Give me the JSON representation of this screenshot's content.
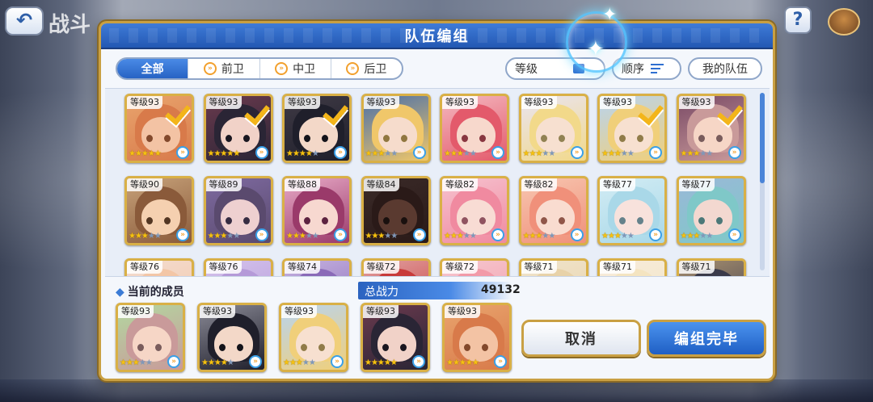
{
  "background": {
    "title": "战斗",
    "help": "?",
    "back_icon": "back-arrow-icon",
    "menu_icon": "menu-icon"
  },
  "dialog": {
    "title": "队伍编组"
  },
  "filters": {
    "tabs": [
      "全部",
      "前卫",
      "中卫",
      "后卫"
    ],
    "active_tab": "全部"
  },
  "controls": {
    "level_label": "等级",
    "sort_label": "顺序",
    "my_team_label": "我的队伍"
  },
  "roster": [
    {
      "level": "等级93",
      "stars": 5,
      "selected": true,
      "skin": "#f3c3a4",
      "hair": "#d87a4a",
      "bg": "#e9a46d"
    },
    {
      "level": "等级93",
      "stars": 5,
      "selected": true,
      "skin": "#f1d2c8",
      "hair": "#2a2535",
      "bg": "#6b3a4e"
    },
    {
      "level": "等级93",
      "stars": 4,
      "selected": true,
      "skin": "#f3d8c8",
      "hair": "#1f1f2b",
      "bg": "#3f3a45"
    },
    {
      "level": "等级93",
      "stars": 3,
      "selected": false,
      "skin": "#f6dccc",
      "hair": "#f0c76a",
      "bg": "#4a6fa8"
    },
    {
      "level": "等级93",
      "stars": 3,
      "selected": false,
      "skin": "#f7d8cc",
      "hair": "#e35a6b",
      "bg": "#f4b8c0"
    },
    {
      "level": "等级93",
      "stars": 3,
      "selected": false,
      "skin": "#f7e0d0",
      "hair": "#f2d98a",
      "bg": "#e9e4f2"
    },
    {
      "level": "等级93",
      "stars": 3,
      "selected": true,
      "skin": "#f7e0d0",
      "hair": "#f0cf7a",
      "bg": "#b8d4f0"
    },
    {
      "level": "等级93",
      "stars": 3,
      "selected": true,
      "skin": "#f6d6c6",
      "hair": "#c99a9a",
      "bg": "#7a4a66"
    },
    {
      "level": "等级90",
      "stars": 3,
      "selected": false,
      "skin": "#f5d0b0",
      "hair": "#8a5a3a",
      "bg": "#c7a27a"
    },
    {
      "level": "等级89",
      "stars": 3,
      "selected": false,
      "skin": "#eed0d0",
      "hair": "#5a4a6e",
      "bg": "#7e6aa0"
    },
    {
      "level": "等级88",
      "stars": 3,
      "selected": false,
      "skin": "#f7d8d0",
      "hair": "#9a3a6a",
      "bg": "#e7a9c6"
    },
    {
      "level": "等级84",
      "stars": 3,
      "selected": false,
      "skin": "#5a3a30",
      "hair": "#2a1a18",
      "bg": "#3a2a28"
    },
    {
      "level": "等级82",
      "stars": 3,
      "selected": false,
      "skin": "#f8dcd4",
      "hair": "#f08aa0",
      "bg": "#f6c2cf"
    },
    {
      "level": "等级82",
      "stars": 3,
      "selected": false,
      "skin": "#f9dcd0",
      "hair": "#f0907a",
      "bg": "#f7c6b0"
    },
    {
      "level": "等级77",
      "stars": 3,
      "selected": false,
      "skin": "#f8e2dc",
      "hair": "#a9d8e8",
      "bg": "#d2ecf4"
    },
    {
      "level": "等级77",
      "stars": 3,
      "selected": false,
      "skin": "#f3d8d0",
      "hair": "#7fc8c8",
      "bg": "#9ab8d8"
    },
    {
      "level": "等级76",
      "stars": 3,
      "selected": false,
      "skin": "#f6dcd0",
      "hair": "#f3c6a6",
      "bg": "#f3dcd0"
    },
    {
      "level": "等级76",
      "stars": 3,
      "selected": false,
      "skin": "#f6dcd0",
      "hair": "#b59ad8",
      "bg": "#d4c2ec"
    },
    {
      "level": "等级74",
      "stars": 3,
      "selected": false,
      "skin": "#f6dcd0",
      "hair": "#8a6ab8",
      "bg": "#c5b2e0"
    },
    {
      "level": "等级72",
      "stars": 3,
      "selected": false,
      "skin": "#f6dcd0",
      "hair": "#c83a3a",
      "bg": "#e0a0a0"
    },
    {
      "level": "等级72",
      "stars": 3,
      "selected": false,
      "skin": "#f6dcd0",
      "hair": "#f29aa8",
      "bg": "#f6c8d0"
    },
    {
      "level": "等级71",
      "stars": 3,
      "selected": false,
      "skin": "#f6dcd0",
      "hair": "#e8d2a8",
      "bg": "#f0e4cc"
    },
    {
      "level": "等级71",
      "stars": 3,
      "selected": false,
      "skin": "#f6dcd0",
      "hair": "#f4e4c0",
      "bg": "#f6ecdc"
    },
    {
      "level": "等级71",
      "stars": 3,
      "selected": false,
      "skin": "#f6dcd0",
      "hair": "#3a3a4a",
      "bg": "#a89070"
    }
  ],
  "members": {
    "label": "当前的成员",
    "power_label": "总战力",
    "power_value": "49132",
    "list": [
      {
        "level": "等级93",
        "stars": 3,
        "skin": "#f6d6c6",
        "hair": "#c99a9a",
        "bg": "#b2d8a0"
      },
      {
        "level": "等级93",
        "stars": 4,
        "skin": "#f3d8c8",
        "hair": "#1f1f2b",
        "bg": "#8a8a96"
      },
      {
        "level": "等级93",
        "stars": 3,
        "skin": "#f7e0d0",
        "hair": "#f0cf7a",
        "bg": "#b8d4f0"
      },
      {
        "level": "等级93",
        "stars": 5,
        "skin": "#f1d2c8",
        "hair": "#2a2535",
        "bg": "#6b3a4e"
      },
      {
        "level": "等级93",
        "stars": 5,
        "skin": "#f3c3a4",
        "hair": "#d87a4a",
        "bg": "#e9a46d"
      }
    ]
  },
  "buttons": {
    "cancel": "取消",
    "confirm": "编组完毕"
  },
  "colors": {
    "accent_blue": "#2f6fd1",
    "gold_border": "#d9b046",
    "check": "#f3b51a"
  }
}
